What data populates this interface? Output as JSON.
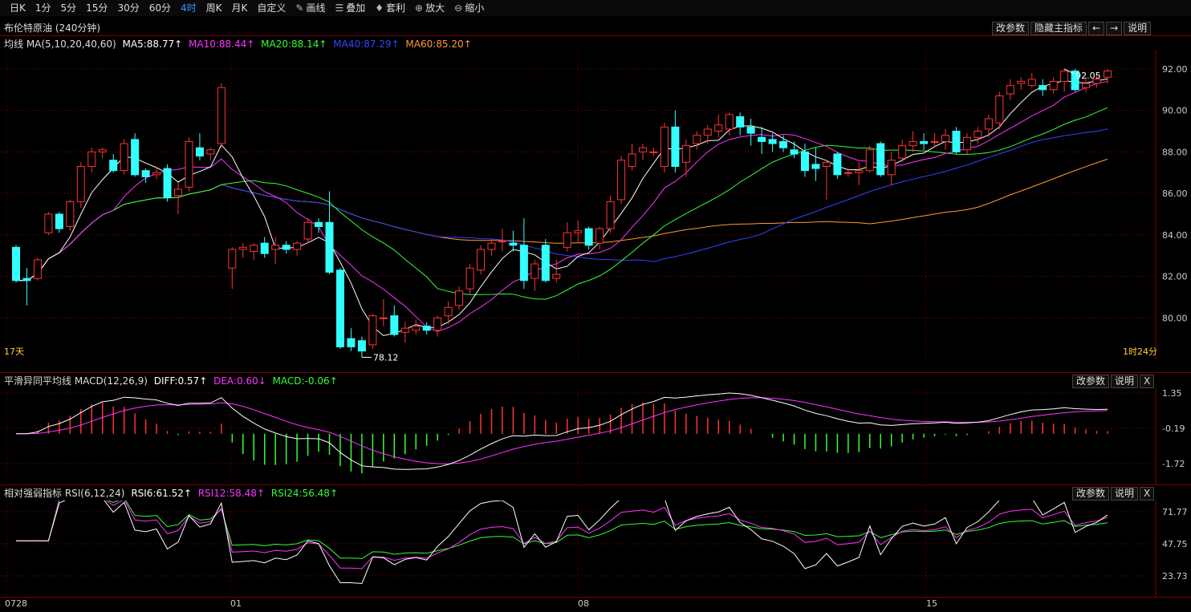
{
  "toolbar": {
    "periods": [
      "日K",
      "1分",
      "5分",
      "15分",
      "30分",
      "60分",
      "4时",
      "周K",
      "月K",
      "自定义"
    ],
    "active_period": "4时",
    "tools": [
      {
        "label": "画线",
        "icon": "pencil-icon"
      },
      {
        "label": "叠加",
        "icon": "stack-icon"
      },
      {
        "label": "套利",
        "icon": "money-bag-icon"
      },
      {
        "label": "放大",
        "icon": "zoom-in-icon"
      },
      {
        "label": "缩小",
        "icon": "zoom-out-icon"
      }
    ]
  },
  "instrument": {
    "name": "布伦特原油 (240分钟)"
  },
  "main_panel": {
    "buttons": [
      "改参数",
      "隐藏主指标",
      "←",
      "→",
      "说明"
    ],
    "indicator_name": "均线 MA(5,10,20,40,60)",
    "ma5": "MA5:88.77↑",
    "ma10": "MA10:88.44↑",
    "ma20": "MA20:88.14↑",
    "ma40": "MA40:87.29↑",
    "ma60": "MA60:85.20↑",
    "y_ticks": [
      "92.00",
      "90.00",
      "88.00",
      "86.00",
      "84.00",
      "82.00",
      "80.00"
    ],
    "high_label": "92.05",
    "low_label": "78.12",
    "left_note": "17天",
    "right_note": "1时24分"
  },
  "macd_panel": {
    "indicator_name": "平滑异同平均线 MACD(12,26,9)",
    "diff": "DIFF:0.57↑",
    "dea": "DEA:0.60↓",
    "macd": "MACD:-0.06↑",
    "buttons": [
      "改参数",
      "说明",
      "X"
    ],
    "y_ticks": [
      "1.35",
      "-0.19",
      "-1.72"
    ]
  },
  "rsi_panel": {
    "indicator_name": "相对强弱指标 RSI(6,12,24)",
    "rsi6": "RSI6:61.52↑",
    "rsi12": "RSI12:58.48↑",
    "rsi24": "RSI24:56.48↑",
    "buttons": [
      "改参数",
      "说明",
      "X"
    ],
    "y_ticks": [
      "71.77",
      "47.75",
      "23.73"
    ]
  },
  "x_axis": {
    "dates": [
      "0728",
      "01",
      "08",
      "15"
    ]
  },
  "colors": {
    "up": "#ff3333",
    "down": "#33ffff",
    "ma5": "#ffffff",
    "ma10": "#ff33ff",
    "ma20": "#33ff33",
    "ma40": "#3344ff",
    "ma60": "#ff9933",
    "grid": "#8b0000"
  },
  "chart_data": {
    "type": "candlestick",
    "y_range": [
      78.0,
      92.5
    ],
    "candles": [
      [
        83.4,
        83.5,
        81.7,
        81.8
      ],
      [
        81.9,
        82.4,
        80.6,
        81.8
      ],
      [
        81.9,
        82.9,
        81.8,
        82.8
      ],
      [
        84.1,
        85.1,
        84.0,
        85.0
      ],
      [
        85.0,
        85.1,
        84.1,
        84.3
      ],
      [
        84.4,
        85.7,
        84.2,
        85.6
      ],
      [
        85.6,
        87.5,
        85.3,
        87.3
      ],
      [
        87.3,
        88.2,
        87.0,
        88.0
      ],
      [
        88.0,
        88.2,
        87.7,
        88.1
      ],
      [
        87.6,
        87.9,
        87.0,
        87.1
      ],
      [
        87.1,
        88.6,
        86.9,
        88.4
      ],
      [
        88.6,
        88.9,
        86.8,
        86.9
      ],
      [
        87.1,
        87.2,
        86.5,
        86.8
      ],
      [
        86.9,
        87.3,
        86.7,
        87.0
      ],
      [
        87.2,
        87.4,
        85.6,
        85.8
      ],
      [
        85.9,
        86.5,
        85.0,
        86.2
      ],
      [
        86.3,
        88.7,
        86.1,
        88.5
      ],
      [
        88.2,
        88.9,
        87.6,
        87.8
      ],
      [
        87.9,
        88.2,
        87.6,
        88.1
      ],
      [
        88.4,
        91.3,
        88.2,
        91.1
      ],
      [
        82.4,
        83.4,
        81.4,
        83.3
      ],
      [
        83.3,
        83.6,
        82.9,
        83.4
      ],
      [
        83.2,
        83.6,
        82.8,
        83.5
      ],
      [
        83.6,
        83.9,
        82.9,
        83.1
      ],
      [
        83.3,
        83.9,
        82.6,
        83.5
      ],
      [
        83.5,
        83.7,
        83.1,
        83.3
      ],
      [
        83.3,
        83.7,
        83.0,
        83.6
      ],
      [
        83.8,
        84.8,
        83.6,
        84.6
      ],
      [
        84.6,
        84.8,
        84.1,
        84.4
      ],
      [
        84.6,
        86.1,
        82.1,
        82.2
      ],
      [
        82.3,
        82.4,
        78.5,
        78.6
      ],
      [
        79.0,
        79.5,
        78.4,
        78.6
      ],
      [
        78.9,
        79.1,
        78.1,
        78.4
      ],
      [
        78.7,
        80.2,
        78.5,
        80.1
      ],
      [
        80.0,
        80.9,
        79.6,
        80.0
      ],
      [
        80.1,
        80.6,
        79.1,
        79.2
      ],
      [
        79.3,
        79.8,
        78.8,
        79.5
      ],
      [
        79.4,
        79.9,
        79.2,
        79.6
      ],
      [
        79.6,
        79.8,
        79.2,
        79.4
      ],
      [
        79.4,
        80.1,
        79.1,
        80.0
      ],
      [
        80.1,
        80.8,
        79.7,
        80.5
      ],
      [
        80.6,
        81.5,
        80.4,
        81.3
      ],
      [
        81.4,
        82.6,
        81.1,
        82.4
      ],
      [
        82.3,
        83.5,
        82.1,
        83.3
      ],
      [
        83.3,
        83.8,
        83.0,
        83.6
      ],
      [
        83.7,
        84.3,
        83.2,
        83.7
      ],
      [
        83.6,
        84.2,
        83.2,
        83.5
      ],
      [
        83.5,
        84.8,
        81.4,
        81.8
      ],
      [
        81.9,
        82.8,
        81.3,
        82.6
      ],
      [
        83.5,
        83.8,
        81.7,
        81.8
      ],
      [
        81.9,
        82.8,
        81.7,
        82.1
      ],
      [
        83.4,
        84.6,
        83.2,
        84.1
      ],
      [
        84.1,
        84.7,
        83.6,
        84.2
      ],
      [
        84.3,
        84.4,
        83.3,
        83.5
      ],
      [
        83.6,
        84.4,
        83.3,
        84.3
      ],
      [
        84.3,
        85.9,
        84.1,
        85.6
      ],
      [
        85.7,
        87.8,
        85.5,
        87.6
      ],
      [
        87.3,
        88.4,
        87.1,
        87.9
      ],
      [
        88.0,
        88.4,
        87.6,
        88.2
      ],
      [
        88.0,
        88.2,
        87.8,
        88.0
      ],
      [
        87.3,
        89.4,
        87.0,
        89.2
      ],
      [
        89.2,
        90.0,
        87.0,
        87.3
      ],
      [
        87.5,
        88.6,
        86.8,
        88.3
      ],
      [
        88.4,
        89.0,
        88.1,
        88.8
      ],
      [
        88.8,
        89.3,
        88.4,
        89.1
      ],
      [
        89.0,
        89.8,
        88.7,
        89.3
      ],
      [
        89.1,
        89.9,
        88.8,
        89.8
      ],
      [
        89.7,
        89.9,
        88.8,
        89.2
      ],
      [
        89.2,
        89.6,
        88.3,
        88.9
      ],
      [
        88.7,
        89.2,
        87.9,
        88.5
      ],
      [
        88.6,
        88.9,
        88.0,
        88.4
      ],
      [
        88.5,
        88.8,
        88.0,
        88.2
      ],
      [
        88.1,
        88.5,
        87.7,
        87.9
      ],
      [
        88.0,
        88.4,
        86.8,
        87.1
      ],
      [
        87.4,
        88.2,
        86.6,
        87.2
      ],
      [
        87.3,
        87.6,
        85.7,
        87.5
      ],
      [
        87.9,
        88.0,
        86.7,
        86.9
      ],
      [
        87.0,
        87.2,
        86.8,
        87.0
      ],
      [
        87.0,
        87.5,
        86.4,
        87.1
      ],
      [
        87.1,
        88.3,
        87.0,
        88.1
      ],
      [
        88.4,
        88.5,
        86.8,
        86.9
      ],
      [
        86.9,
        88.0,
        86.4,
        87.6
      ],
      [
        87.7,
        88.6,
        87.5,
        88.3
      ],
      [
        88.3,
        89.0,
        88.0,
        88.5
      ],
      [
        88.5,
        88.9,
        88.1,
        88.4
      ],
      [
        88.5,
        88.9,
        88.2,
        88.5
      ],
      [
        88.5,
        89.1,
        88.1,
        88.8
      ],
      [
        89.0,
        89.2,
        87.9,
        88.0
      ],
      [
        88.1,
        88.9,
        87.9,
        88.7
      ],
      [
        88.7,
        89.2,
        88.4,
        89.0
      ],
      [
        89.1,
        89.8,
        88.7,
        89.6
      ],
      [
        89.4,
        90.9,
        89.1,
        90.7
      ],
      [
        90.8,
        91.5,
        90.5,
        91.2
      ],
      [
        91.3,
        91.6,
        91.0,
        91.4
      ],
      [
        91.2,
        91.8,
        91.1,
        91.5
      ],
      [
        91.2,
        91.5,
        90.7,
        91.0
      ],
      [
        91.0,
        91.6,
        90.8,
        91.4
      ],
      [
        91.4,
        92.0,
        90.9,
        91.9
      ],
      [
        91.9,
        92.0,
        90.9,
        91.0
      ],
      [
        91.1,
        91.6,
        90.9,
        91.3
      ],
      [
        91.3,
        91.8,
        91.1,
        91.5
      ],
      [
        91.6,
        92.0,
        91.3,
        91.9
      ]
    ]
  }
}
